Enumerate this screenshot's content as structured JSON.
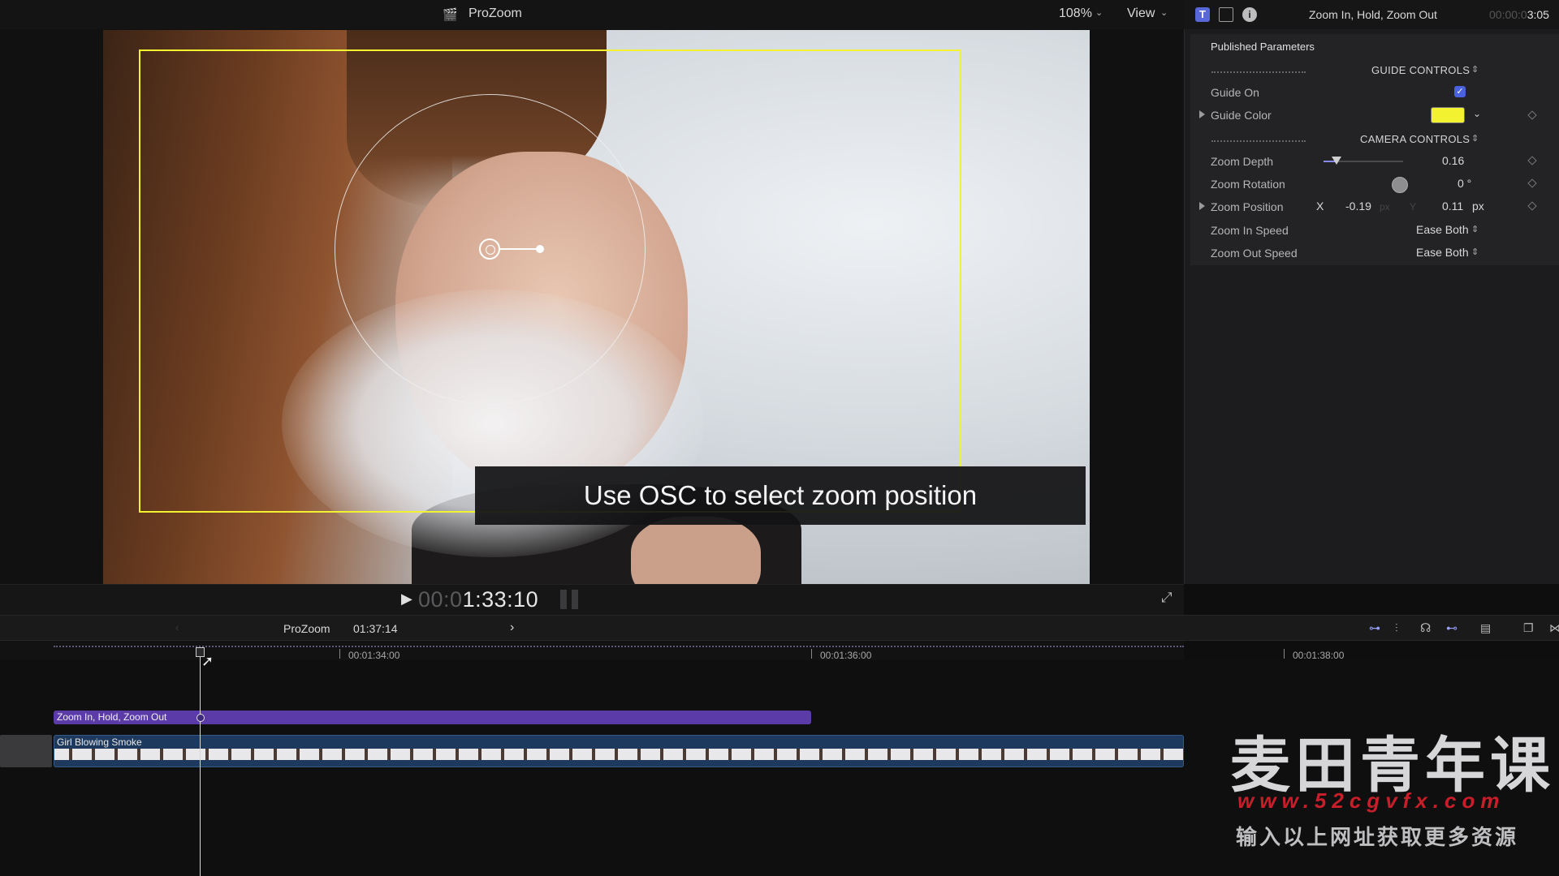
{
  "viewer": {
    "title": "ProZoom",
    "zoom": "108%",
    "view_menu": "View",
    "caption": "Use OSC to select zoom position",
    "timecode_dim": "00:0",
    "timecode": "1:33:10"
  },
  "inspector": {
    "title": "Zoom In, Hold, Zoom Out",
    "duration_dim": "00:00:0",
    "duration": "3:05",
    "section": "Published Parameters",
    "guide_controls": "GUIDE CONTROLS",
    "guide_on_label": "Guide On",
    "guide_color_label": "Guide Color",
    "guide_color": "#f2f230",
    "camera_controls": "CAMERA CONTROLS",
    "zoom_depth_label": "Zoom Depth",
    "zoom_depth_value": "0.16",
    "zoom_depth_slider": 0.16,
    "zoom_rotation_label": "Zoom Rotation",
    "zoom_rotation_value": "0 °",
    "zoom_position_label": "Zoom Position",
    "zoom_position_x_label": "X",
    "zoom_position_x": "-0.19",
    "zoom_position_x_unit": "px",
    "zoom_position_y_label": "Y",
    "zoom_position_y": "0.11",
    "zoom_position_y_unit": "px",
    "zoom_in_speed_label": "Zoom In Speed",
    "zoom_in_speed": "Ease Both",
    "zoom_out_speed_label": "Zoom Out Speed",
    "zoom_out_speed": "Ease Both"
  },
  "timeline": {
    "project": "ProZoom",
    "duration": "01:37:14",
    "ruler": [
      "00:01:34:00",
      "00:01:36:00",
      "00:01:38:00"
    ],
    "title_clip": "Zoom In, Hold, Zoom Out",
    "video_clip": "Girl Blowing Smoke"
  },
  "watermark": {
    "title": "麦田青年课",
    "url": "www.52cgvfx.com",
    "note": "输入以上网址获取更多资源"
  },
  "colors": {
    "accent": "#5b3ba8",
    "guide": "#f2f230",
    "video_clip": "#1d3a5e"
  }
}
